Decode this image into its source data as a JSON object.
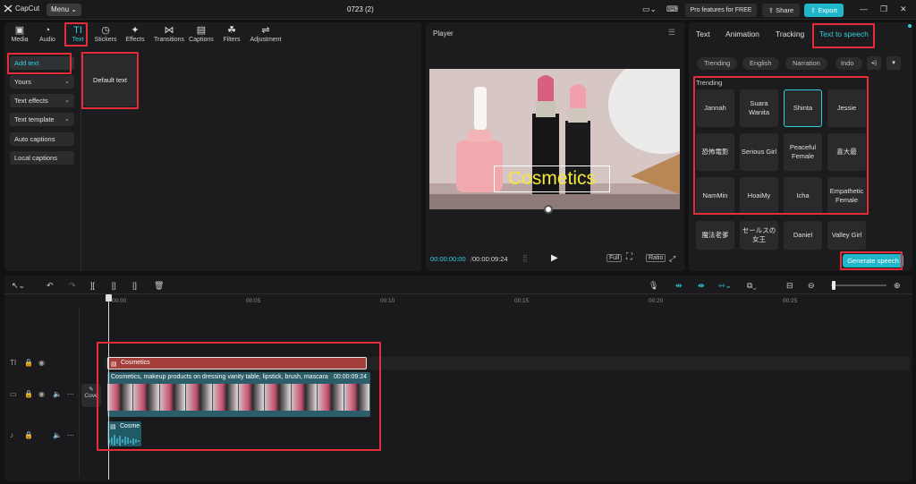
{
  "app": {
    "name": "CapCut",
    "menu_label": "Menu",
    "project_title": "0723 (2)"
  },
  "header": {
    "pro_label": "Pro features for FREE",
    "share_label": "Share",
    "export_label": "Export"
  },
  "toolbar": [
    {
      "label": "Media",
      "icon": "media-icon"
    },
    {
      "label": "Audio",
      "icon": "audio-icon"
    },
    {
      "label": "Text",
      "icon": "text-icon"
    },
    {
      "label": "Stickers",
      "icon": "stickers-icon"
    },
    {
      "label": "Effects",
      "icon": "effects-icon"
    },
    {
      "label": "Transitions",
      "icon": "transitions-icon"
    },
    {
      "label": "Captions",
      "icon": "captions-icon"
    },
    {
      "label": "Filters",
      "icon": "filters-icon"
    },
    {
      "label": "Adjustment",
      "icon": "adjustment-icon"
    }
  ],
  "sidebar": {
    "items": [
      {
        "label": "Add text",
        "dropdown": false
      },
      {
        "label": "Yours",
        "dropdown": true
      },
      {
        "label": "Text effects",
        "dropdown": true
      },
      {
        "label": "Text template",
        "dropdown": true
      },
      {
        "label": "Auto captions",
        "dropdown": false
      },
      {
        "label": "Local captions",
        "dropdown": false
      }
    ]
  },
  "text_panel": {
    "default_card": "Default text"
  },
  "player": {
    "title": "Player",
    "overlay_text": "Cosmetics",
    "current_time": "00:00:00:00",
    "total_time": "00:00:09:24",
    "full_label": "Full",
    "ratio_label": "Ratio"
  },
  "right_panel": {
    "tabs": [
      "Text",
      "Animation",
      "Tracking",
      "Text to speech"
    ],
    "chips": [
      "Trending",
      "English",
      "Narration",
      "Indo"
    ],
    "section_label": "Trending",
    "voices": [
      "Jannah",
      "Suara Wanita",
      "Shinta",
      "Jessie",
      "恐怖電影",
      "Serious Girl",
      "Peaceful Female",
      "喜大最",
      "NamMin",
      "HoaiMy",
      "Icha",
      "Empathetic Female",
      "魔法老爹",
      "セールスの女王",
      "Daniel",
      "Valley Girl"
    ],
    "selected_voice": "Shinta",
    "generate_label": "Generate speech"
  },
  "timeline": {
    "ruler": [
      "00:00",
      "00:05",
      "00:10",
      "00:15",
      "00:20",
      "00:25"
    ],
    "text_clip": "Cosmetics",
    "video_clip_label": "Cosmetics, makeup products on dressing vanity table, lipstick, brush, mascara",
    "video_clip_duration": "00:00:09:24",
    "audio_clip": "Cosme",
    "cover_label": "Cove"
  },
  "colors": {
    "accent": "#1fb6c9",
    "highlight": "#e52d39",
    "text_clip": "#a33e3b",
    "video_clip": "#2b5e68"
  }
}
